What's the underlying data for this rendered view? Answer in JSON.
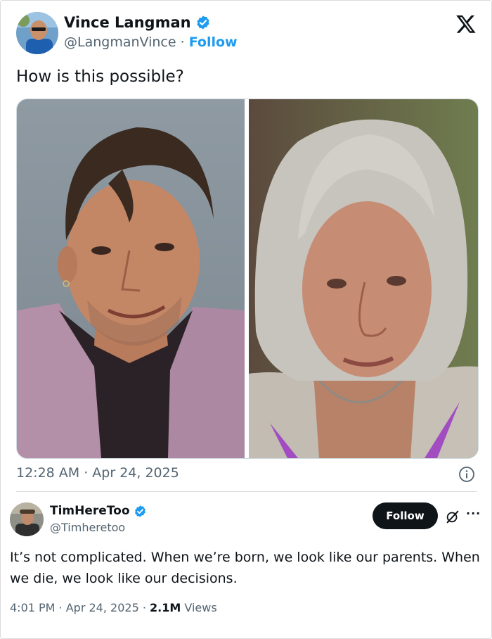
{
  "tweet": {
    "author_name": "Vince Langman",
    "author_handle": "@LangmanVince",
    "separator": " · ",
    "follow_label": "Follow",
    "text": "How is this possible?",
    "timestamp": "12:28 AM · Apr 24, 2025",
    "verified": true,
    "images": [
      {
        "description": "young-man-photo"
      },
      {
        "description": "older-man-photo"
      }
    ]
  },
  "reply": {
    "author_name": "TimHereToo",
    "author_handle": "@Timheretoo",
    "verified": true,
    "follow_button_label": "Follow",
    "text": "It’s not complicated. When we’re born, we look like our parents. When we die, we look like our decisions.",
    "time": "4:01 PM · Apr 24, 2025 · ",
    "views_count": "2.1M",
    "views_label": " Views"
  },
  "colors": {
    "accent": "#1d9bf0",
    "text_primary": "#0f1419",
    "text_secondary": "#536471",
    "follow_button_bg": "#0f1419"
  },
  "icons": [
    "verified-badge-icon",
    "x-logo-icon",
    "info-icon",
    "grok-icon",
    "more-icon"
  ]
}
